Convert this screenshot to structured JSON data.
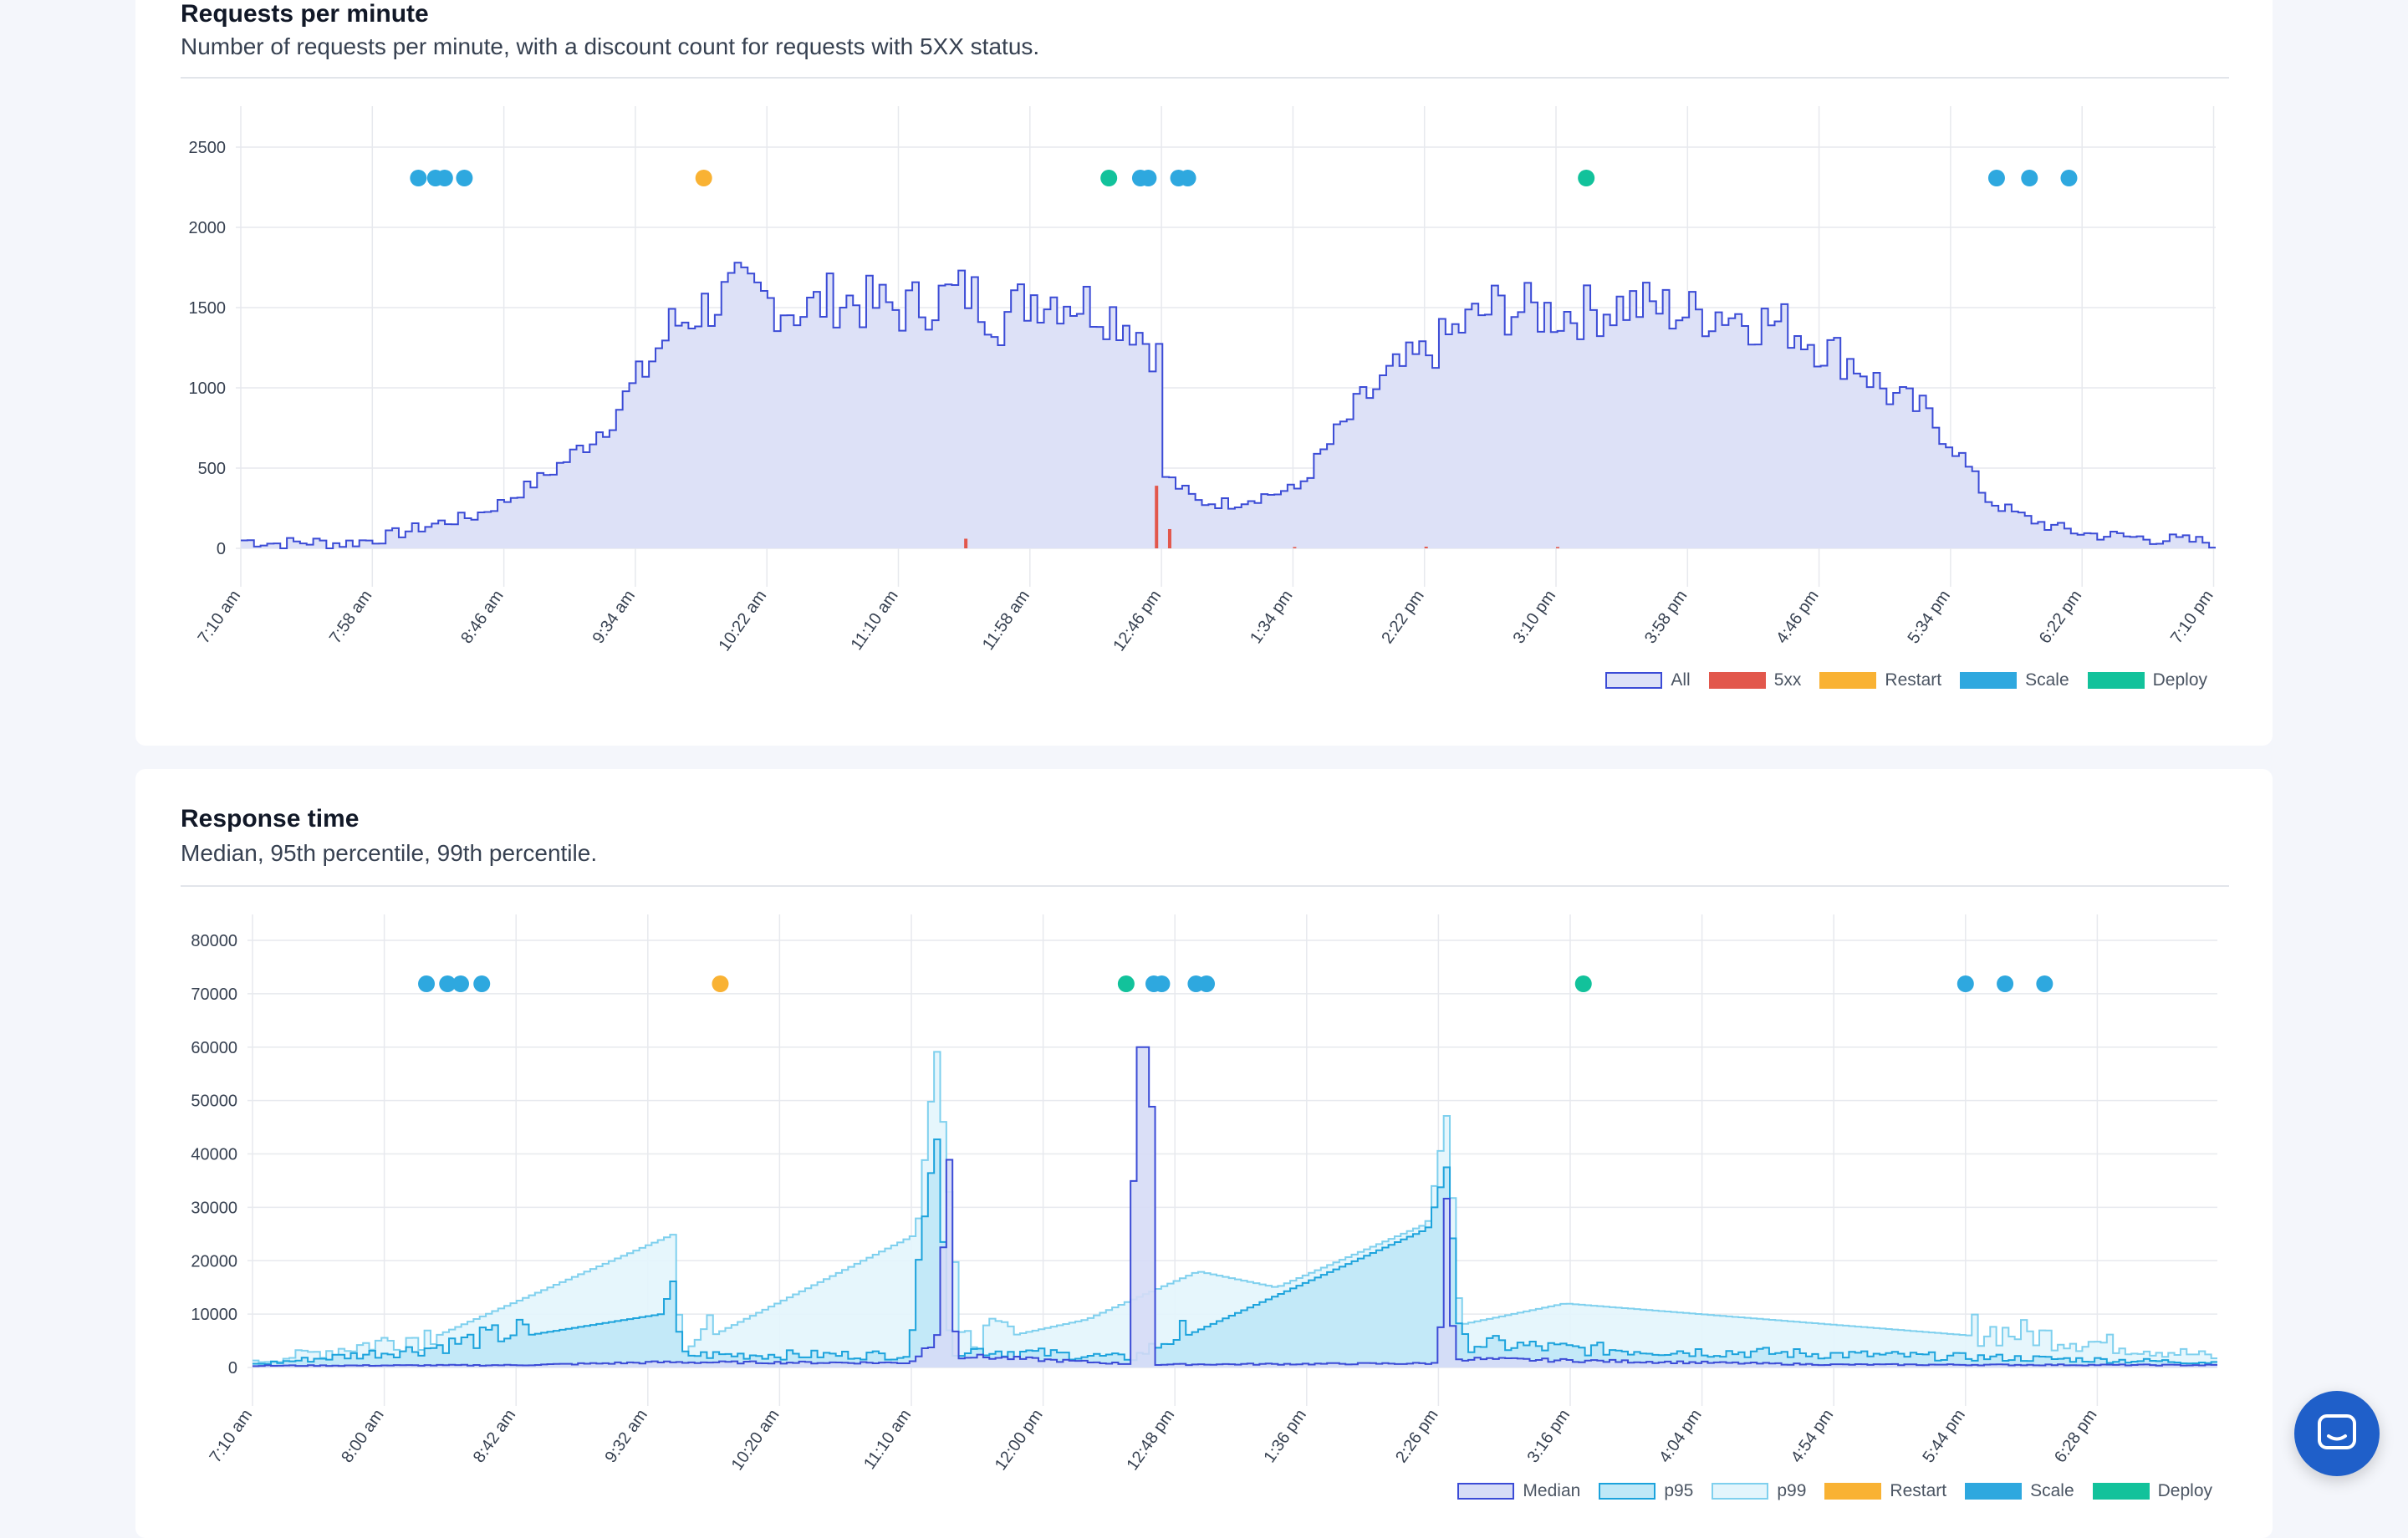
{
  "colors": {
    "all_fill": "#dde1f7",
    "all_line": "#3b4bd6",
    "err": "#e2574c",
    "restart": "#f9b233",
    "scale": "#2ea8df",
    "deploy": "#12c29b",
    "median_fill": "#d6dcf6",
    "median_line": "#3b4bd6",
    "p95_fill": "#bfe8f7",
    "p95_line": "#1ca3dc",
    "p99_fill": "#e3f5fc",
    "p99_line": "#7fd0ee",
    "grid": "#e7e9ee",
    "tick": "#374151"
  },
  "requests_chart": {
    "title": "Requests per minute",
    "subtitle": "Number of requests per minute, with a discount count for requests with 5XX status.",
    "legend": [
      {
        "label": "All",
        "key": "all"
      },
      {
        "label": "5xx",
        "key": "err"
      },
      {
        "label": "Restart",
        "key": "restart"
      },
      {
        "label": "Scale",
        "key": "scale"
      },
      {
        "label": "Deploy",
        "key": "deploy"
      }
    ]
  },
  "response_chart": {
    "title": "Response time",
    "subtitle": "Median, 95th percentile, 99th percentile.",
    "legend": [
      {
        "label": "Median",
        "key": "median"
      },
      {
        "label": "p95",
        "key": "p95"
      },
      {
        "label": "p99",
        "key": "p99"
      },
      {
        "label": "Restart",
        "key": "restart"
      },
      {
        "label": "Scale",
        "key": "scale"
      },
      {
        "label": "Deploy",
        "key": "deploy"
      }
    ]
  },
  "chart_data": [
    {
      "type": "area",
      "title": "Requests per minute",
      "ylim": [
        0,
        2500
      ],
      "yticks": [
        0,
        500,
        1000,
        1500,
        2000,
        2500
      ],
      "xticks": [
        "7:10 am",
        "7:58 am",
        "8:46 am",
        "9:34 am",
        "10:22 am",
        "11:10 am",
        "11:58 am",
        "12:46 pm",
        "1:34 pm",
        "2:22 pm",
        "3:10 pm",
        "3:58 pm",
        "4:46 pm",
        "5:34 pm",
        "6:22 pm",
        "7:10 pm"
      ],
      "grid": true,
      "legend_position": "bottom-right",
      "series": [
        {
          "name": "All",
          "points": [
            [
              0,
              50
            ],
            [
              0.25,
              30
            ],
            [
              0.5,
              40
            ],
            [
              0.75,
              30
            ],
            [
              1,
              55
            ],
            [
              1.25,
              110
            ],
            [
              1.5,
              160
            ],
            [
              1.75,
              200
            ],
            [
              2,
              300
            ],
            [
              2.25,
              430
            ],
            [
              2.5,
              580
            ],
            [
              2.75,
              770
            ],
            [
              3,
              1050
            ],
            [
              3.25,
              1380
            ],
            [
              3.5,
              1500
            ],
            [
              3.75,
              1600
            ],
            [
              4,
              1540
            ],
            [
              4.25,
              1480
            ],
            [
              4.5,
              1560
            ],
            [
              4.75,
              1520
            ],
            [
              5,
              1490
            ],
            [
              5.25,
              1550
            ],
            [
              5.5,
              1600
            ],
            [
              5.75,
              1430
            ],
            [
              6,
              1580
            ],
            [
              6.25,
              1560
            ],
            [
              6.5,
              1500
            ],
            [
              6.75,
              1400
            ],
            [
              6.95,
              1200
            ],
            [
              7.0,
              450
            ],
            [
              7.25,
              290
            ],
            [
              7.5,
              280
            ],
            [
              7.75,
              330
            ],
            [
              8,
              370
            ],
            [
              8.25,
              650
            ],
            [
              8.5,
              920
            ],
            [
              8.75,
              1100
            ],
            [
              9,
              1220
            ],
            [
              9.25,
              1380
            ],
            [
              9.5,
              1500
            ],
            [
              9.75,
              1480
            ],
            [
              10,
              1460
            ],
            [
              10.25,
              1480
            ],
            [
              10.5,
              1520
            ],
            [
              10.75,
              1500
            ],
            [
              11,
              1460
            ],
            [
              11.25,
              1480
            ],
            [
              11.5,
              1420
            ],
            [
              11.75,
              1380
            ],
            [
              12,
              1250
            ],
            [
              12.25,
              1150
            ],
            [
              12.5,
              960
            ],
            [
              12.75,
              860
            ],
            [
              13,
              630
            ],
            [
              13.25,
              300
            ],
            [
              13.5,
              200
            ],
            [
              13.75,
              130
            ],
            [
              14,
              90
            ],
            [
              14.5,
              60
            ],
            [
              15,
              35
            ]
          ]
        },
        {
          "name": "5xx",
          "points": [
            [
              5.5,
              60
            ],
            [
              6.95,
              390
            ],
            [
              7.05,
              120
            ],
            [
              8.0,
              8
            ],
            [
              9.0,
              10
            ],
            [
              10.0,
              8
            ]
          ]
        }
      ],
      "events": [
        {
          "type": "Scale",
          "x": 1.35
        },
        {
          "type": "Scale",
          "x": 1.48
        },
        {
          "type": "Scale",
          "x": 1.55
        },
        {
          "type": "Scale",
          "x": 1.7
        },
        {
          "type": "Restart",
          "x": 3.52
        },
        {
          "type": "Deploy",
          "x": 6.6
        },
        {
          "type": "Scale",
          "x": 6.84
        },
        {
          "type": "Scale",
          "x": 6.9
        },
        {
          "type": "Scale",
          "x": 7.13
        },
        {
          "type": "Scale",
          "x": 7.2
        },
        {
          "type": "Deploy",
          "x": 10.23
        },
        {
          "type": "Scale",
          "x": 13.35
        },
        {
          "type": "Scale",
          "x": 13.6
        },
        {
          "type": "Scale",
          "x": 13.9
        }
      ]
    },
    {
      "type": "area",
      "title": "Response time",
      "ylim": [
        0,
        80000
      ],
      "yticks": [
        0,
        10000,
        20000,
        30000,
        40000,
        50000,
        60000,
        70000,
        80000
      ],
      "xticks": [
        "7:10 am",
        "8:00 am",
        "8:42 am",
        "9:32 am",
        "10:20 am",
        "11:10 am",
        "12:00 pm",
        "12:48 pm",
        "1:36 pm",
        "2:26 pm",
        "3:16 pm",
        "4:04 pm",
        "4:54 pm",
        "5:44 pm",
        "6:28 pm"
      ],
      "grid": true,
      "legend_position": "bottom-right",
      "series": [
        {
          "name": "Median",
          "points": [
            [
              0,
              300
            ],
            [
              2,
              400
            ],
            [
              3.1,
              900
            ],
            [
              5,
              800
            ],
            [
              5.2,
              5000
            ],
            [
              5.3,
              40000
            ],
            [
              5.35,
              2000
            ],
            [
              6.68,
              600
            ],
            [
              6.72,
              60000
            ],
            [
              6.84,
              60000
            ],
            [
              6.86,
              500
            ],
            [
              9,
              700
            ],
            [
              9.05,
              8000
            ],
            [
              9.1,
              35000
            ],
            [
              9.15,
              1500
            ],
            [
              12,
              500
            ],
            [
              15,
              400
            ]
          ]
        },
        {
          "name": "p95",
          "points": [
            [
              0,
              500
            ],
            [
              1.3,
              3000
            ],
            [
              3.1,
              10000
            ],
            [
              3.2,
              17000
            ],
            [
              3.25,
              2000
            ],
            [
              5,
              2000
            ],
            [
              5.05,
              18000
            ],
            [
              5.2,
              44000
            ],
            [
              5.3,
              3000
            ],
            [
              6.7,
              1500
            ],
            [
              8.95,
              26000
            ],
            [
              9.1,
              38000
            ],
            [
              9.2,
              4000
            ],
            [
              10,
              3000
            ],
            [
              15,
              800
            ]
          ]
        },
        {
          "name": "p99",
          "points": [
            [
              0,
              800
            ],
            [
              1.3,
              5000
            ],
            [
              3.2,
              25000
            ],
            [
              3.25,
              3000
            ],
            [
              5.05,
              25000
            ],
            [
              5.2,
              60000
            ],
            [
              5.35,
              18000
            ],
            [
              5.4,
              4000
            ],
            [
              6.35,
              9000
            ],
            [
              7.2,
              18000
            ],
            [
              7.8,
              15000
            ],
            [
              8.95,
              27000
            ],
            [
              9.1,
              48000
            ],
            [
              9.2,
              8000
            ],
            [
              10,
              12000
            ],
            [
              13.6,
              5000
            ],
            [
              15,
              1500
            ]
          ]
        }
      ],
      "events": [
        {
          "type": "Scale",
          "x": 1.32
        },
        {
          "type": "Scale",
          "x": 1.48
        },
        {
          "type": "Scale",
          "x": 1.58
        },
        {
          "type": "Scale",
          "x": 1.74
        },
        {
          "type": "Restart",
          "x": 3.55
        },
        {
          "type": "Deploy",
          "x": 6.63
        },
        {
          "type": "Scale",
          "x": 6.84
        },
        {
          "type": "Scale",
          "x": 6.9
        },
        {
          "type": "Scale",
          "x": 7.16
        },
        {
          "type": "Scale",
          "x": 7.24
        },
        {
          "type": "Deploy",
          "x": 10.1
        },
        {
          "type": "Scale",
          "x": 13.0
        },
        {
          "type": "Scale",
          "x": 13.3
        },
        {
          "type": "Scale",
          "x": 13.6
        }
      ]
    }
  ],
  "help_button": {
    "icon": "chat-icon"
  }
}
